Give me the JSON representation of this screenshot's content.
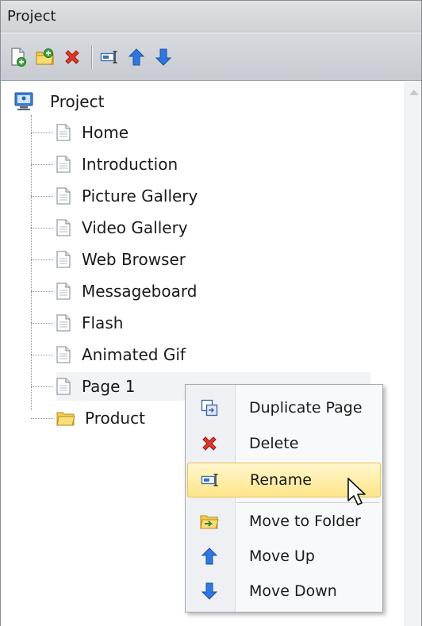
{
  "panel": {
    "title": "Project",
    "toolbar": [
      {
        "name": "add-page-icon"
      },
      {
        "name": "add-folder-icon"
      },
      {
        "name": "delete-icon"
      },
      {
        "name": "rename-icon"
      },
      {
        "name": "move-up-icon"
      },
      {
        "name": "move-down-icon"
      }
    ]
  },
  "tree": {
    "root_label": "Project",
    "items": [
      {
        "label": "Home",
        "icon": "page-icon"
      },
      {
        "label": "Introduction",
        "icon": "page-icon"
      },
      {
        "label": "Picture Gallery",
        "icon": "page-icon"
      },
      {
        "label": "Video Gallery",
        "icon": "page-icon"
      },
      {
        "label": "Web Browser",
        "icon": "page-icon"
      },
      {
        "label": "Messageboard",
        "icon": "page-icon"
      },
      {
        "label": "Flash",
        "icon": "page-icon"
      },
      {
        "label": "Animated Gif",
        "icon": "page-icon"
      },
      {
        "label": "Page 1",
        "icon": "page-icon"
      },
      {
        "label": "Product",
        "icon": "folder-icon"
      }
    ]
  },
  "context_menu": {
    "items": [
      {
        "label": "Duplicate Page",
        "icon": "duplicate-icon"
      },
      {
        "label": "Delete",
        "icon": "delete-icon"
      },
      {
        "label": "Rename",
        "icon": "rename-icon"
      },
      {
        "label": "Move to Folder",
        "icon": "move-to-folder-icon"
      },
      {
        "label": "Move Up",
        "icon": "arrow-up-icon"
      },
      {
        "label": "Move Down",
        "icon": "arrow-down-icon"
      }
    ]
  },
  "colors": {
    "menu_highlight": "#ffe58a",
    "arrow_blue": "#2f78e0",
    "delete_red": "#e0382a"
  }
}
